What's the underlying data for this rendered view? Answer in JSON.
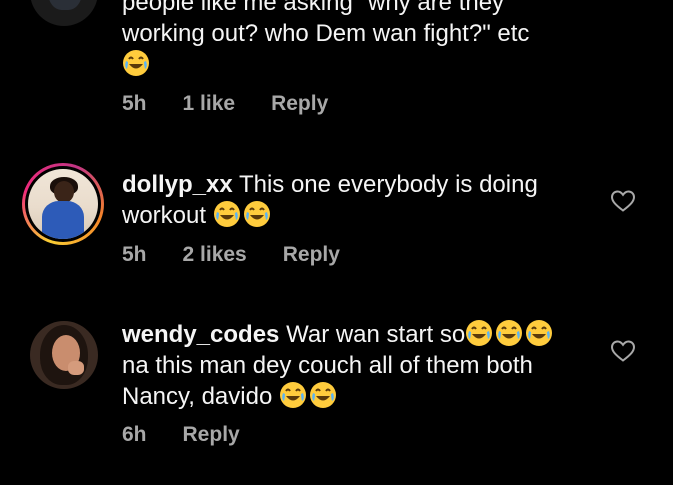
{
  "comments": [
    {
      "username": "",
      "text_line1": "people like me asking \"why are they",
      "text_line2": "working out? who Dem wan fight?\" etc",
      "emoji_count": 1,
      "time": "5h",
      "likes": "1 like",
      "reply": "Reply"
    },
    {
      "username": "dollyp_xx",
      "text": "This one everybody is doing workout",
      "emoji_count": 2,
      "time": "5h",
      "likes": "2 likes",
      "reply": "Reply"
    },
    {
      "username": "wendy_codes",
      "text": "War wan start so",
      "emoji_count_line1": 3,
      "text_line2": "na this man dey couch all of them both",
      "text_line3": "Nancy, davido",
      "emoji_count_line3": 2,
      "time": "6h",
      "reply": "Reply"
    }
  ],
  "icons": {
    "heart": "heart-outline-icon",
    "emoji": "face-with-tears-of-joy-emoji"
  },
  "colors": {
    "background": "#000000",
    "text": "#f5f5f5",
    "meta": "#a8a8a8",
    "story_ring": "#ee2a7b"
  }
}
